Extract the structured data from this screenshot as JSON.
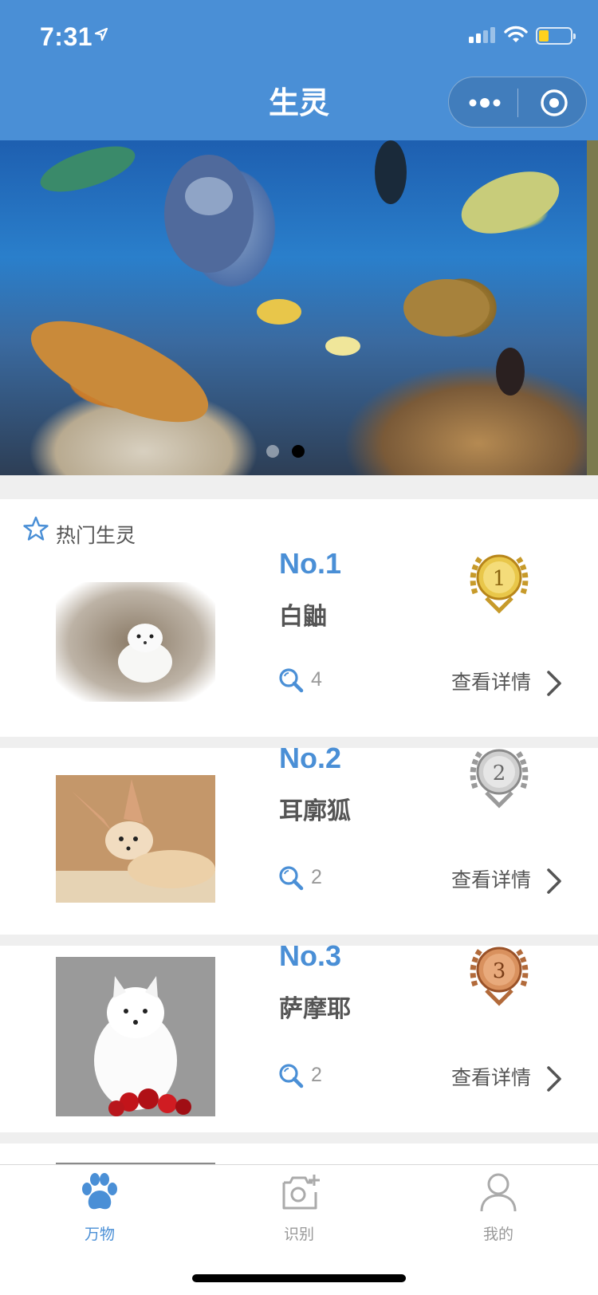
{
  "status_bar": {
    "time": "7:31",
    "battery_color": "#ffd21f"
  },
  "nav": {
    "title": "生灵"
  },
  "colors": {
    "accent": "#4a8fd6",
    "text": "#555555",
    "muted": "#999999"
  },
  "banner": {
    "slide_count": 2,
    "active_slide": 2
  },
  "section": {
    "title": "热门生灵",
    "icon": "star-icon"
  },
  "animals": [
    {
      "rank": "No.1",
      "name": "白鼬",
      "views": "4",
      "detail": "查看详情",
      "medal": "1",
      "medal_type": "gold"
    },
    {
      "rank": "No.2",
      "name": "耳廓狐",
      "views": "2",
      "detail": "查看详情",
      "medal": "2",
      "medal_type": "silver"
    },
    {
      "rank": "No.3",
      "name": "萨摩耶",
      "views": "2",
      "detail": "查看详情",
      "medal": "3",
      "medal_type": "bronze"
    }
  ],
  "tabbar": [
    {
      "label": "万物",
      "icon": "paw-icon",
      "active": true
    },
    {
      "label": "识别",
      "icon": "camera-add-icon",
      "active": false
    },
    {
      "label": "我的",
      "icon": "user-icon",
      "active": false
    }
  ]
}
